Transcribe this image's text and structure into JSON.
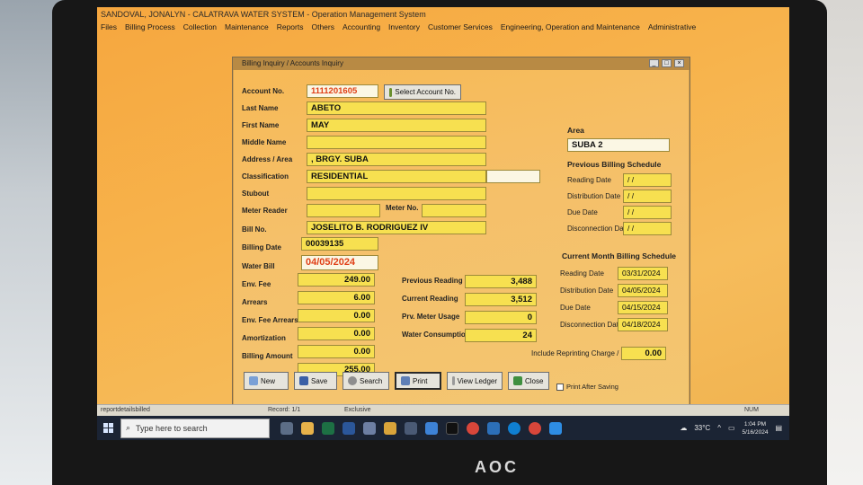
{
  "app": {
    "title": "SANDOVAL, JONALYN - CALATRAVA WATER SYSTEM - Operation Management System",
    "menu": [
      "Files",
      "Billing Process",
      "Collection",
      "Maintenance",
      "Reports",
      "Others",
      "Accounting",
      "Inventory",
      "Customer Services",
      "Engineering, Operation and Maintenance",
      "Administrative"
    ]
  },
  "window": {
    "title": "Billing Inquiry / Accounts Inquiry",
    "controls": [
      "_",
      "□",
      "×"
    ]
  },
  "form": {
    "labels": {
      "account_no": "Account No.",
      "last_name": "Last Name",
      "first_name": "First Name",
      "middle_name": "Middle Name",
      "address": "Address / Area",
      "classification": "Classification",
      "stubout": "Stubout",
      "meter_no": "Meter No.",
      "meter_reader": "Meter Reader",
      "bill_no": "Bill No.",
      "billing_date": "Billing Date",
      "water_bill": "Water Bill",
      "env_fee": "Env. Fee",
      "arrears": "Arrears",
      "env_fee_arrears": "Env. Fee Arrears",
      "amortization": "Amortization",
      "billing_amount": "Billing Amount",
      "previous_reading": "Previous Reading",
      "current_reading": "Current Reading",
      "prv_meter_usage": "Prv. Meter Usage",
      "water_consumption": "Water Consumption",
      "area": "Area",
      "include_reprinting": "Include Reprinting Charge / Fee"
    },
    "values": {
      "account_no": "1111201605",
      "last_name": "ABETO",
      "first_name": "MAY",
      "middle_name": "",
      "address": ", BRGY. SUBA",
      "classification": "RESIDENTIAL",
      "stubout": "",
      "meter_no": "",
      "meter_reader": "JOSELITO B. RODRIGUEZ IV",
      "bill_no": "00039135",
      "billing_date": "04/05/2024",
      "water_bill": "249.00",
      "env_fee": "6.00",
      "arrears": "0.00",
      "env_fee_arrears": "0.00",
      "amortization": "0.00",
      "billing_amount": "255.00",
      "previous_reading": "3,488",
      "current_reading": "3,512",
      "prv_meter_usage": "0",
      "water_consumption": "24",
      "area": "SUBA 2",
      "reprinting_fee": "0.00"
    },
    "select_account_label": "Select Account No."
  },
  "previous_schedule": {
    "heading": "Previous Billing Schedule",
    "labels": [
      "Reading Date",
      "Distribution Date",
      "Due Date",
      "Disconnection Date"
    ],
    "values": [
      "/ /",
      "/ /",
      "/ /",
      "/ /"
    ]
  },
  "current_schedule": {
    "heading": "Current Month Billing Schedule",
    "labels": [
      "Reading Date",
      "Distribution Date",
      "Due Date",
      "Disconnection Date"
    ],
    "values": [
      "03/31/2024",
      "04/05/2024",
      "04/15/2024",
      "04/18/2024"
    ]
  },
  "buttons": {
    "new": "New",
    "save": "Save",
    "search": "Search",
    "print": "Print",
    "view_ledger": "View Ledger",
    "close": "Close",
    "print_after_saving": "Print After Saving"
  },
  "status": {
    "left": "reportdetailsbilled",
    "record": "Record: 1/1",
    "mode": "Exclusive",
    "num": "NUM"
  },
  "taskbar": {
    "search_placeholder": "Type here to search",
    "weather": "33°C",
    "time": "1:04 PM",
    "date": "5/16/2024"
  },
  "monitor_brand": "AOC"
}
